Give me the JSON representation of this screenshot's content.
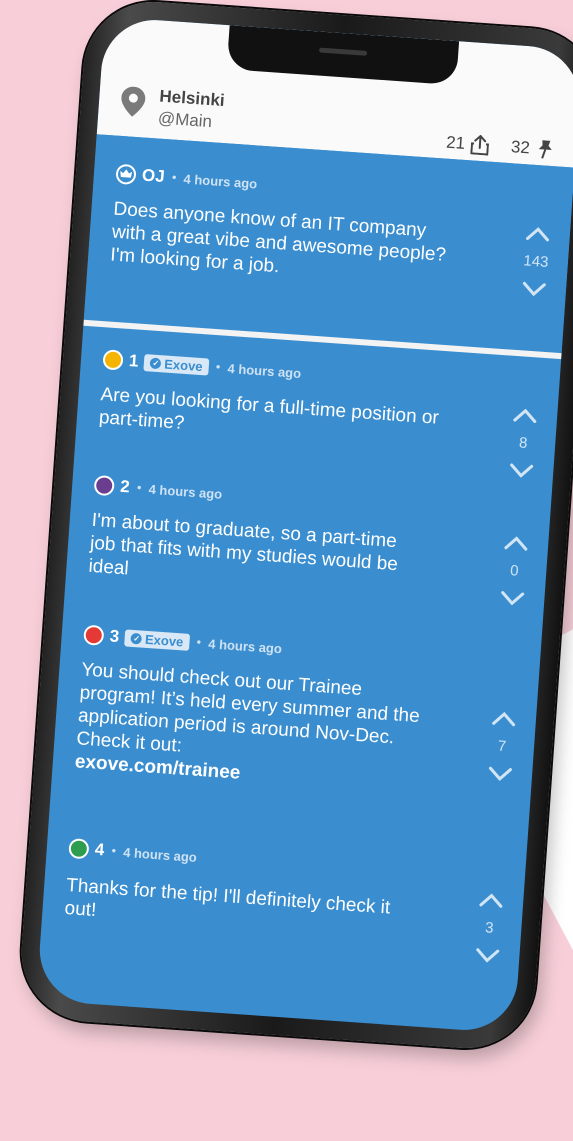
{
  "header": {
    "location": "Helsinki",
    "channel": "@Main",
    "shares": "21",
    "pins": "32"
  },
  "post": {
    "user": "OJ",
    "time": "4 hours ago",
    "text": "Does anyone know of an IT company with a great vibe and awesome people? I'm looking for a job.",
    "votes": "143"
  },
  "replies": [
    {
      "user": "1",
      "badge": "Exove",
      "time": "4 hours ago",
      "text": "Are you looking for a full-time position or part-time?",
      "votes": "8",
      "color": "#f5b400"
    },
    {
      "user": "2",
      "time": "4 hours ago",
      "text": "I'm about to graduate, so a part-time job that fits with my studies would be ideal",
      "votes": "0",
      "color": "#6a3d8f"
    },
    {
      "user": "3",
      "badge": "Exove",
      "time": "4 hours ago",
      "text": "You should check out our Trainee program! It’s held every summer and the application period is around Nov-Dec. Check it out:",
      "link": "exove.com/trainee",
      "votes": "7",
      "color": "#e53935"
    },
    {
      "user": "4",
      "time": "4 hours ago",
      "text": "Thanks for the tip! I'll definitely check it out!",
      "votes": "3",
      "color": "#2e9d4f"
    }
  ],
  "colors": {
    "background": "#f8cfd9",
    "feed": "#3a8ed0",
    "header": "#fafafa"
  }
}
